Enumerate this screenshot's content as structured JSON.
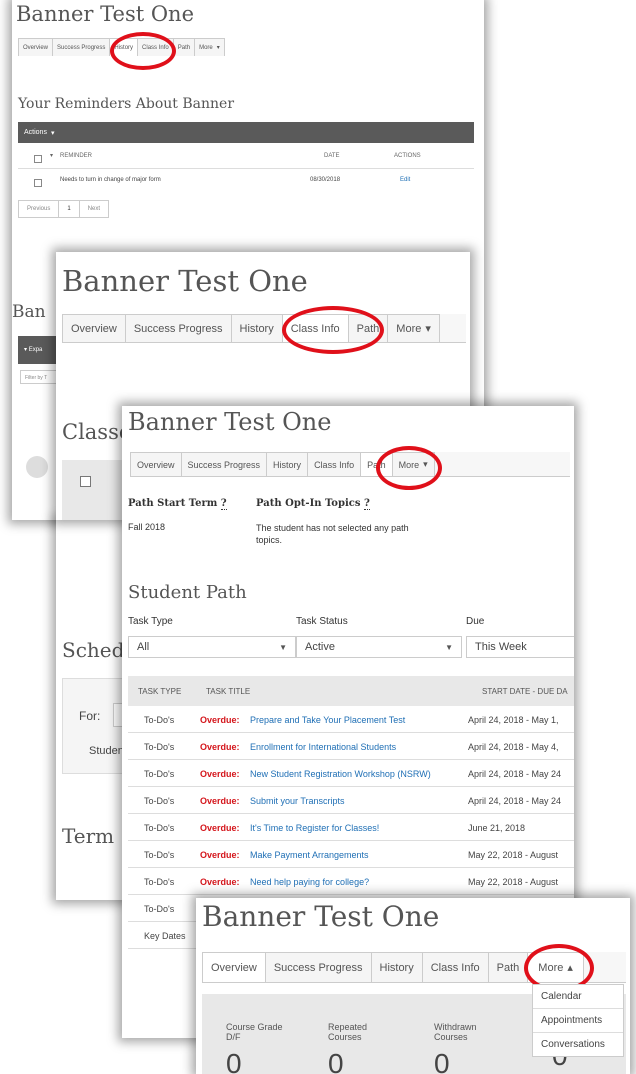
{
  "panel1": {
    "title": "Banner Test One",
    "tabs": [
      "Overview",
      "Success Progress",
      "History",
      "Class Info",
      "Path",
      "More"
    ],
    "section_title": "Your Reminders About Banner",
    "actions_label": "Actions",
    "columns": [
      "REMINDER",
      "DATE",
      "ACTIONS"
    ],
    "rows": [
      {
        "reminder": "Needs to turn in change of major form",
        "date": "08/30/2018",
        "action": "Edit"
      }
    ],
    "pagination": {
      "previous": "Previous",
      "page": "1",
      "next": "Next"
    }
  },
  "panel1_partial": {
    "heading_ban": "Ban",
    "expand": "Expa",
    "filter_placeholder": "Filter by T",
    "classes": "Classe",
    "sched": "Sched",
    "for_label": "For:",
    "student": "Studen",
    "term": "Term"
  },
  "panel2": {
    "title": "Banner Test One",
    "tabs": [
      "Overview",
      "Success Progress",
      "History",
      "Class Info",
      "Path",
      "More"
    ]
  },
  "panel3": {
    "title": "Banner Test One",
    "tabs": [
      "Overview",
      "Success Progress",
      "History",
      "Class Info",
      "Path",
      "More"
    ],
    "path_start_label": "Path Start Term",
    "path_start_value": "Fall 2018",
    "opt_in_label": "Path Opt-In Topics",
    "opt_in_value": "The student has not selected any path topics.",
    "student_path": "Student Path",
    "filters": [
      {
        "label": "Task Type",
        "value": "All"
      },
      {
        "label": "Task Status",
        "value": "Active"
      },
      {
        "label": "Due",
        "value": "This Week"
      }
    ],
    "columns": [
      "TASK TYPE",
      "TASK TITLE",
      "START DATE - DUE DA"
    ],
    "overdue_label": "Overdue:",
    "tasks": [
      {
        "type": "To-Do's",
        "title": "Prepare and Take Your Placement Test",
        "dates": "April 24, 2018 - May 1,",
        "overdue": true
      },
      {
        "type": "To-Do's",
        "title": "Enrollment for International Students",
        "dates": "April 24, 2018 - May 4,",
        "overdue": true
      },
      {
        "type": "To-Do's",
        "title": "New Student Registration Workshop (NSRW)",
        "dates": "April 24, 2018 - May 24",
        "overdue": true
      },
      {
        "type": "To-Do's",
        "title": "Submit your Transcripts",
        "dates": "April 24, 2018 - May 24",
        "overdue": true
      },
      {
        "type": "To-Do's",
        "title": "It's Time to Register for Classes!",
        "dates": "June 21, 2018",
        "overdue": true
      },
      {
        "type": "To-Do's",
        "title": "Make Payment Arrangements",
        "dates": "May 22, 2018 - August",
        "overdue": true
      },
      {
        "type": "To-Do's",
        "title": "Need help paying for college?",
        "dates": "May 22, 2018 - August",
        "overdue": true
      },
      {
        "type": "To-Do's",
        "title": "",
        "dates": "",
        "overdue": false
      },
      {
        "type": "Key Dates",
        "title": "",
        "dates": "",
        "overdue": false
      }
    ]
  },
  "panel4": {
    "title": "Banner Test One",
    "tabs": [
      "Overview",
      "Success Progress",
      "History",
      "Class Info",
      "Path",
      "More"
    ],
    "menu": [
      "Calendar",
      "Appointments",
      "Conversations"
    ],
    "stats": [
      {
        "label": "Course Grade D/F",
        "value": "0"
      },
      {
        "label": "Repeated Courses",
        "value": "0"
      },
      {
        "label": "Withdrawn Courses",
        "value": "0"
      },
      {
        "label": "",
        "value": "0"
      }
    ]
  },
  "colors": {
    "highlight": "#e0101a",
    "header_bar": "#5a5a5a",
    "link": "#1f6fb5",
    "overdue": "#d4151b"
  }
}
